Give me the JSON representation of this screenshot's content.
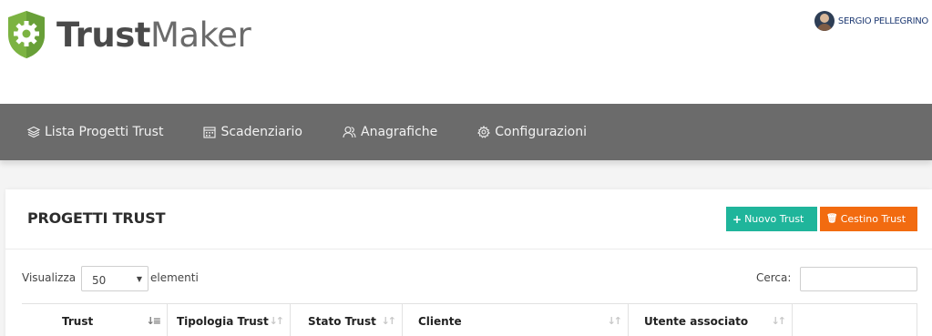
{
  "header": {
    "logo_bold": "Trust",
    "logo_light": "Maker",
    "user_name": "SERGIO PELLEGRINO",
    "logo_icon": "gear-shield-icon",
    "accent_green": "#7cb342"
  },
  "nav": {
    "items": [
      {
        "label": "Lista Progetti Trust",
        "icon": "layers-icon"
      },
      {
        "label": "Scadenziario",
        "icon": "calendar-icon"
      },
      {
        "label": "Anagrafiche",
        "icon": "users-icon"
      },
      {
        "label": "Configurazioni",
        "icon": "gear-icon"
      }
    ]
  },
  "card": {
    "title": "PROGETTI TRUST",
    "btn_new": {
      "icon": "+",
      "label": "Nuovo Trust",
      "color": "#1fb59b"
    },
    "btn_trash": {
      "icon": "🗑",
      "label": "Cestino Trust",
      "color": "#f26b10"
    }
  },
  "controls": {
    "show_label": "Visualizza",
    "length_value": "50",
    "entries_label": "elementi",
    "search_label": "Cerca:",
    "search_value": ""
  },
  "table": {
    "columns": [
      {
        "label": "Trust",
        "sort_active": true
      },
      {
        "label": "Tipologia Trust",
        "sort_active": false
      },
      {
        "label": "Stato Trust",
        "sort_active": false
      },
      {
        "label": "Cliente",
        "sort_active": false
      },
      {
        "label": "Utente associato",
        "sort_active": false
      },
      {
        "label": "",
        "sort_active": false
      }
    ]
  }
}
